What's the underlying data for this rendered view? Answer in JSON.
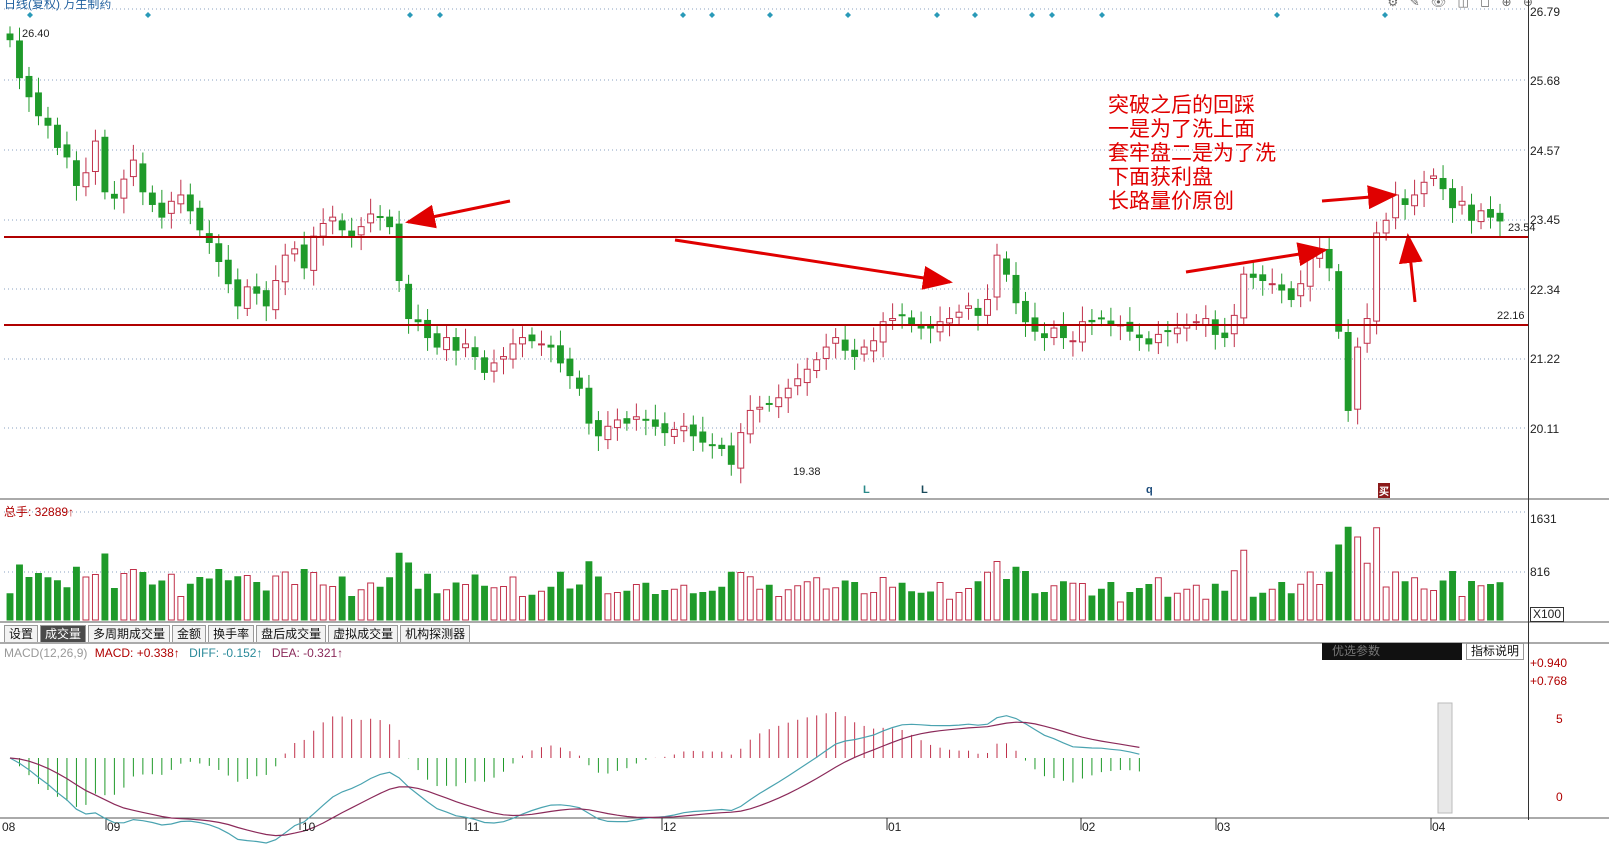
{
  "header": {
    "title": "日线(复权) 万生制药",
    "controls": "⚙ ✎ 👁 ◫ ◻ ⊕ ⊖"
  },
  "colors": {
    "up": "#c0304a",
    "down": "#1f9a2a",
    "support_line": "#b00000",
    "annotation": "#e00000",
    "diff": "#4aa3b0",
    "dea": "#8b2a5a"
  },
  "price_axis": {
    "ticks": [
      "26.79",
      "25.68",
      "24.57",
      "23.45",
      "22.34",
      "21.22",
      "20.11"
    ],
    "high_label": "26.40",
    "low_label": "19.38",
    "current_label": "23.54",
    "line_label_b": "22.16"
  },
  "annotation": {
    "lines": [
      "突破之后的回踩",
      "一是为了洗上面",
      "套牢盘二是为了洗",
      "下面获利盘",
      "长路量价原创"
    ]
  },
  "markers": {
    "L1": "L",
    "L2": "L",
    "Q": "q",
    "buy": "买"
  },
  "volume_panel": {
    "title": "总手: 32889↑",
    "ticks": [
      "1631",
      "816"
    ],
    "unit": "X100"
  },
  "tabs": [
    "设置",
    "成交量",
    "多周期成交量",
    "金额",
    "换手率",
    "盘后成交量",
    "虚拟成交量",
    "机构探测器"
  ],
  "macd_panel": {
    "name": "MACD(12,26,9)",
    "macd": "MACD: +0.338↑",
    "diff": "DIFF: -0.152↑",
    "dea": "DEA: -0.321↑",
    "btn_params": "优选参数",
    "btn_help": "指标说明",
    "ticks": [
      "+0.940",
      "+0.768",
      "5",
      "0"
    ]
  },
  "x_axis": {
    "months": [
      "08",
      "09",
      "10",
      "11",
      "12",
      "01",
      "02",
      "03",
      "04"
    ]
  },
  "chart_data": {
    "type": "candlestick",
    "title": "日线(复权) 万生制药",
    "ylim": [
      19.2,
      26.9
    ],
    "price_high": 26.4,
    "price_low": 19.38,
    "last_close": 23.54,
    "support_lines": [
      23.25,
      21.85
    ],
    "closes": [
      26.4,
      25.8,
      25.5,
      25.2,
      25.05,
      24.7,
      24.55,
      24.1,
      24.3,
      24.8,
      24.0,
      23.9,
      24.2,
      24.5,
      24.0,
      23.8,
      23.6,
      23.85,
      23.95,
      23.7,
      23.4,
      23.2,
      22.9,
      22.55,
      22.2,
      22.5,
      22.4,
      22.2,
      22.6,
      23.0,
      23.1,
      22.8,
      23.3,
      23.5,
      23.6,
      23.4,
      23.3,
      23.45,
      23.65,
      23.6,
      23.45,
      22.6,
      22.0,
      21.95,
      21.7,
      21.55,
      21.7,
      21.5,
      21.6,
      21.4,
      21.15,
      21.3,
      21.4,
      21.6,
      21.7,
      21.65,
      21.6,
      21.55,
      21.3,
      21.1,
      20.9,
      20.35,
      20.15,
      20.3,
      20.4,
      20.35,
      20.45,
      20.4,
      20.3,
      20.2,
      20.25,
      20.3,
      20.15,
      20.05,
      20.0,
      19.95,
      19.7,
      20.2,
      20.55,
      20.6,
      20.65,
      20.75,
      20.9,
      21.05,
      21.2,
      21.35,
      21.55,
      21.7,
      21.5,
      21.4,
      21.55,
      21.65,
      21.95,
      22.0,
      22.05,
      21.9,
      21.85,
      21.85,
      21.95,
      22.0,
      22.1,
      22.2,
      22.05,
      22.3,
      23.0,
      22.7,
      22.25,
      21.95,
      21.8,
      21.7,
      21.85,
      21.7,
      21.65,
      21.95,
      21.95,
      22.0,
      21.9,
      21.9,
      21.8,
      21.7,
      21.6,
      21.75,
      21.8,
      21.85,
      21.9,
      21.95,
      22.0,
      21.75,
      21.7,
      22.05,
      22.7,
      22.65,
      22.6,
      22.55,
      22.45,
      22.3,
      22.55,
      22.95,
      23.05,
      22.8,
      21.8,
      20.55,
      21.55,
      22.0,
      23.35,
      23.55,
      23.95,
      23.8,
      23.95,
      24.15,
      24.25,
      24.05,
      23.75,
      23.85,
      23.55,
      23.7,
      23.6,
      23.54
    ]
  }
}
